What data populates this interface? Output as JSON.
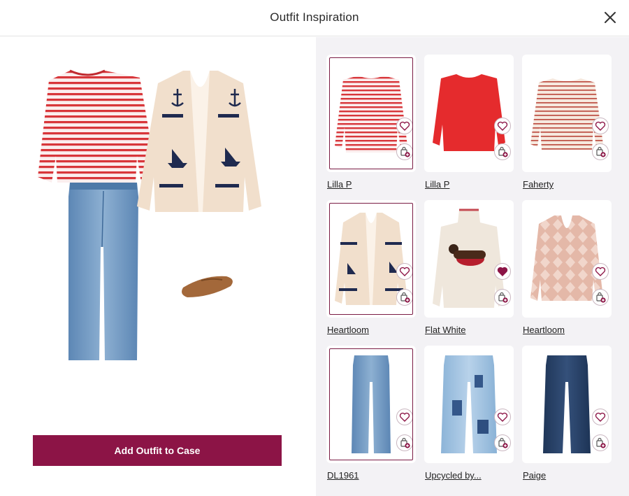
{
  "header": {
    "title": "Outfit Inspiration"
  },
  "outfit": {
    "add_button_label": "Add Outfit to Case"
  },
  "colors": {
    "accent": "#8c1446",
    "panel_bg": "#f3f2f5"
  },
  "products": [
    {
      "brand": "Lilla P",
      "item": "red striped boatneck tee",
      "favorited": false,
      "selected": true
    },
    {
      "brand": "Lilla P",
      "item": "red long-sleeve top",
      "favorited": false,
      "selected": false
    },
    {
      "brand": "Faherty",
      "item": "striped boatneck tee",
      "favorited": false,
      "selected": false
    },
    {
      "brand": "Heartloom",
      "item": "nautical cardigan",
      "favorited": false,
      "selected": true
    },
    {
      "brand": "Flat White",
      "item": "dachshund turtleneck sweater",
      "favorited": true,
      "selected": false
    },
    {
      "brand": "Heartloom",
      "item": "pink argyle cardigan",
      "favorited": false,
      "selected": false
    },
    {
      "brand": "DL1961",
      "item": "flare jeans",
      "favorited": false,
      "selected": true
    },
    {
      "brand": "Upcycled by...",
      "item": "patchwork jeans",
      "favorited": false,
      "selected": false
    },
    {
      "brand": "Paige",
      "item": "dark wide-leg jeans",
      "favorited": false,
      "selected": false
    }
  ],
  "icons": {
    "close": "close-icon",
    "heart": "heart-icon",
    "bag": "add-to-bag-icon"
  }
}
